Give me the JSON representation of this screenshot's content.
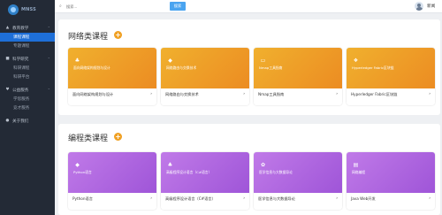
{
  "app": {
    "logo_text": "MNSS"
  },
  "sidebar": {
    "groups": [
      {
        "label": "教育教学",
        "icon": "graduation-icon",
        "items": [
          {
            "label": "课程课程",
            "active": true
          },
          {
            "label": "专题课程",
            "active": false
          }
        ]
      },
      {
        "label": "科学研究",
        "icon": "research-icon",
        "items": [
          {
            "label": "科研课程",
            "active": false
          },
          {
            "label": "科研平台",
            "active": false
          }
        ]
      },
      {
        "label": "公益服务",
        "icon": "service-icon",
        "items": [
          {
            "label": "学思服务",
            "active": false
          },
          {
            "label": "竞才服务",
            "active": false
          }
        ]
      },
      {
        "label": "关于我们",
        "icon": "info-icon",
        "items": []
      }
    ]
  },
  "header": {
    "search_placeholder": "搜索...",
    "search_button": "搜索",
    "user_name": "新闻"
  },
  "floating": {
    "primary_label": "课程管理",
    "secondary_label": "服务我们"
  },
  "sections": [
    {
      "title": "网络类课程",
      "color": "#ec8c22",
      "cards": [
        {
          "banner_text": "面向网络架构规划与设计",
          "name": "面向网络架构规划与设计",
          "icon": "network-icon"
        },
        {
          "banner_text": "网络路由与交换技术",
          "name": "网络路由与交换技术",
          "icon": "router-icon"
        },
        {
          "banner_text": "Nmap工具指南",
          "name": "Nmap工具指南",
          "icon": "monitor-icon"
        },
        {
          "banner_text": "Hyperledger Fabric区块链",
          "name": "Hyperledger Fabric区块链",
          "icon": "blockchain-icon"
        }
      ]
    },
    {
      "title": "编程类课程",
      "color": "#9f55d8",
      "cards": [
        {
          "banner_text": "Python语言",
          "name": "Python语言",
          "icon": "python-icon"
        },
        {
          "banner_text": "高级程序设计语言（C#语言）",
          "name": "高级程序设计语言（C#语言）",
          "icon": "code-icon"
        },
        {
          "banner_text": "医学信息与大数据导论",
          "name": "医学信息与大数据导论",
          "icon": "data-icon"
        },
        {
          "banner_text": "网络编程",
          "name": "Java Web开发",
          "icon": "web-icon"
        }
      ]
    }
  ],
  "colors": {
    "sidebar_bg": "#232a36",
    "active": "#1e6fd8",
    "accent_plus": "#f0a023"
  }
}
